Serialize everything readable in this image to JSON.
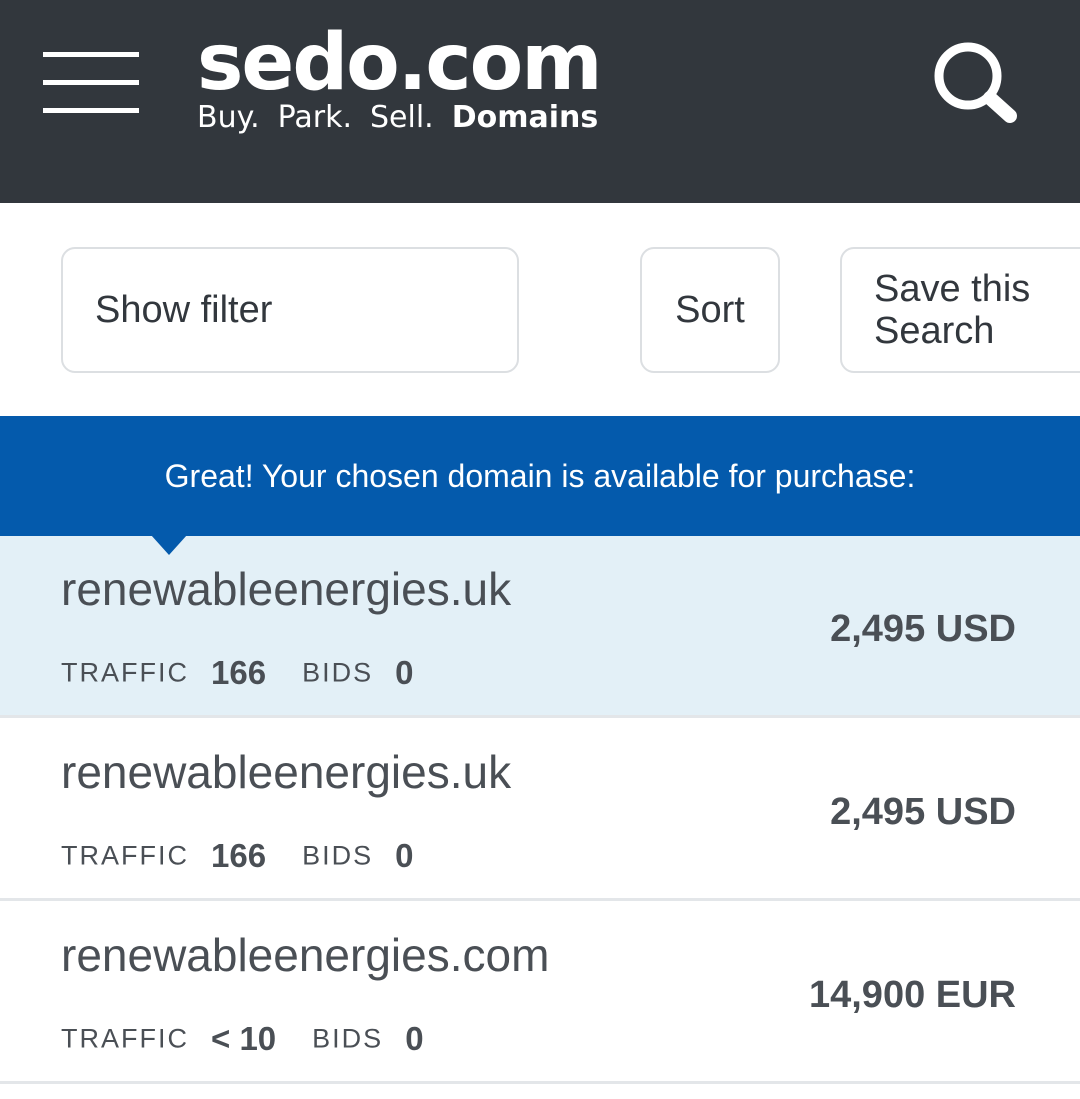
{
  "header": {
    "logo": "sedo.com",
    "tagline": [
      "Buy.",
      "Park.",
      "Sell.",
      "Domains"
    ]
  },
  "toolbar": {
    "filter_label": "Show filter",
    "sort_label": "Sort",
    "save_label": "Save this Search"
  },
  "banner": {
    "message": "Great! Your chosen domain is available for purchase:"
  },
  "results": [
    {
      "domain": "renewableenergies.uk",
      "traffic_label": "TRAFFIC",
      "traffic": "166",
      "bids_label": "BIDS",
      "bids": "0",
      "price": "2,495 USD",
      "highlighted": true
    },
    {
      "domain": "renewableenergies.uk",
      "traffic_label": "TRAFFIC",
      "traffic": "166",
      "bids_label": "BIDS",
      "bids": "0",
      "price": "2,495 USD",
      "highlighted": false
    },
    {
      "domain": "renewableenergies.com",
      "traffic_label": "TRAFFIC",
      "traffic": "< 10",
      "bids_label": "BIDS",
      "bids": "0",
      "price": "14,900 EUR",
      "highlighted": false
    }
  ],
  "colors": {
    "header_bg": "#32373d",
    "banner_bg": "#045aac",
    "highlight_bg": "#e3f0f7",
    "text": "#4a4f55"
  },
  "icons": {
    "menu": "hamburger-menu-icon",
    "search": "search-icon"
  }
}
